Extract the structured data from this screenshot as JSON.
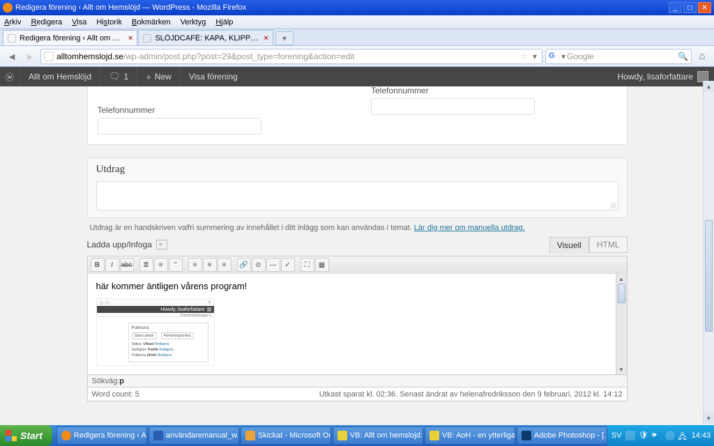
{
  "window": {
    "title": "Redigera förening ‹ Allt om Hemslöjd — WordPress - Mozilla Firefox"
  },
  "menubar": {
    "items": [
      "Arkiv",
      "Redigera",
      "Visa",
      "Historik",
      "Bokmärken",
      "Verktyg",
      "Hjälp"
    ]
  },
  "tabs": {
    "t1": "Redigera förening ‹ Allt om Hemslöjd — ...",
    "t2": "SLÖJDCAFÉ: KAPA, KLIPP OCH SKAPA A..."
  },
  "url": {
    "host": "alltomhemslojd.se",
    "path": "/wp-admin/post.php?post=29&post_type=forening&action=edit"
  },
  "search": {
    "placeholder": "Google"
  },
  "wpbar": {
    "site": "Allt om Hemslöjd",
    "comments": "1",
    "new": "New",
    "view": "Visa förening",
    "howdy": "Howdy, lisaforfattare"
  },
  "fields": {
    "phone_label": "Telefonnummer"
  },
  "excerpt": {
    "title": "Utdrag",
    "help_pre": "Utdrag är en handskriven valfri summering av innehållet i ditt inlägg som kan användas i temat. ",
    "help_link": "Lär dig mer om manuella utdrag."
  },
  "editor": {
    "upload": "Ladda upp/Infoga",
    "tab_visual": "Visuell",
    "tab_html": "HTML",
    "body_text": "här kommer äntligen vårens program!",
    "thumb": {
      "howdy": "Howdy, lisaforfattare",
      "panel_title": "Publicera",
      "btn1": "Spara utkast",
      "btn2": "Förhandsgranska",
      "status_lbl": "Status:",
      "status_val": "Utkast",
      "status_lnk": "Redigera",
      "vis_lbl": "Synlighet:",
      "vis_val": "Publik",
      "vis_lnk": "Redigera",
      "pub_lbl": "Publicera",
      "pub_val": "direkt",
      "pub_lnk": "Redigera"
    },
    "path_label": "Sökväg: ",
    "path_value": "p",
    "wordcount_label": "Word count: ",
    "wordcount_value": "5",
    "savestatus": "Utkast sparat kl. 02:36. Senast ändrat av helenafredriksson den 9 februari, 2012 kl. 14:12"
  },
  "taskbar": {
    "start": "Start",
    "items": {
      "i1": "Redigera förening ‹ A...",
      "i2": "användaremanual_w...",
      "i3": "Skickat - Microsoft Ou...",
      "i4": "VB: Allt om hemslojd: ...",
      "i5": "VB: AoH - en ytterliga...",
      "i6": "Adobe Photoshop - [..."
    },
    "lang": "SV",
    "time": "14:43"
  }
}
